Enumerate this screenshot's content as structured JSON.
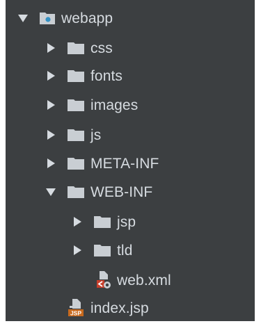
{
  "project_tree": {
    "root": {
      "label": "webapp",
      "expanded": true,
      "icon": "web-module-folder-icon"
    },
    "items": [
      {
        "label": "css",
        "expanded": false,
        "icon": "folder-icon"
      },
      {
        "label": "fonts",
        "expanded": false,
        "icon": "folder-icon"
      },
      {
        "label": "images",
        "expanded": false,
        "icon": "folder-icon"
      },
      {
        "label": "js",
        "expanded": false,
        "icon": "folder-icon"
      },
      {
        "label": "META-INF",
        "expanded": false,
        "icon": "folder-icon"
      },
      {
        "label": "WEB-INF",
        "expanded": true,
        "icon": "folder-icon"
      },
      {
        "label": "jsp",
        "expanded": false,
        "icon": "folder-icon"
      },
      {
        "label": "tld",
        "expanded": false,
        "icon": "folder-icon"
      },
      {
        "label": "web.xml",
        "icon": "xml-file-icon"
      },
      {
        "label": "index.jsp",
        "icon": "jsp-file-icon"
      }
    ]
  },
  "colors": {
    "panel_bg": "#3c3f41",
    "text": "#d6dbe0",
    "folder": "#c9ced3",
    "module_dot": "#3592c4",
    "jsp_badge": "#c86a1e",
    "xml_badge": "#c63f2c"
  }
}
